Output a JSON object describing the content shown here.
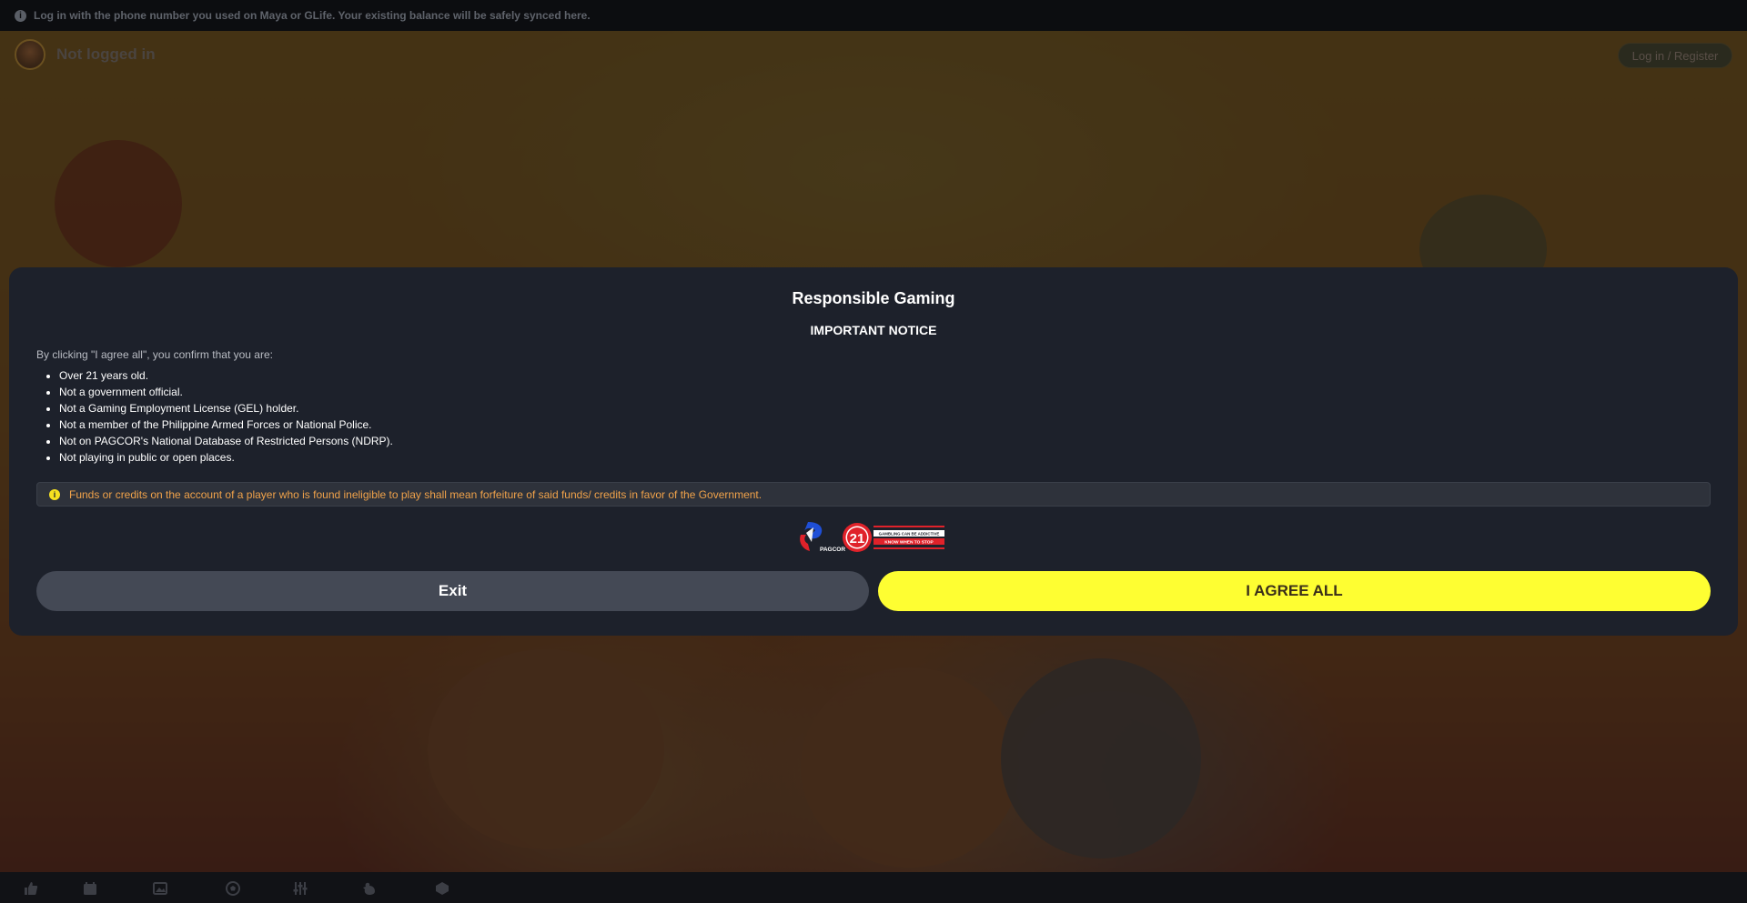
{
  "topbar": {
    "message": "Log in with the phone number you used on Maya or GLife. Your existing balance will be safely synced here."
  },
  "header": {
    "status": "Not logged in",
    "login_label": "Log in / Register"
  },
  "modal": {
    "title": "Responsible Gaming",
    "subtitle": "IMPORTANT NOTICE",
    "intro": "By clicking \"I agree all\", you confirm that you are:",
    "conditions": [
      "Over 21 years old.",
      "Not a government official.",
      "Not a Gaming Employment License (GEL) holder.",
      "Not a member of the Philippine Armed Forces or National Police.",
      "Not on PAGCOR's National Database of Restricted Persons (NDRP).",
      "Not playing in public or open places."
    ],
    "warning": "Funds or credits on the account of a player who is found ineligible to play shall mean forfeiture of said funds/ credits in favor of the Government.",
    "logos": {
      "pagcor": "PAGCOR",
      "age": "21",
      "tag_top": "GAMBLING CAN BE ADDICTIVE",
      "tag_bottom": "KNOW WHEN TO STOP"
    },
    "exit_label": "Exit",
    "agree_label": "I AGREE ALL"
  },
  "bottom_nav": {
    "icons": [
      "thumbs-up-icon",
      "calendar-icon",
      "image-icon",
      "soccer-ball-icon",
      "sliders-icon",
      "rooster-icon",
      "dice-icon"
    ]
  },
  "colors": {
    "agree_button": "#fefe32",
    "exit_button": "#444955",
    "modal_bg": "#1d212b",
    "warning_text": "#f0a24a"
  }
}
